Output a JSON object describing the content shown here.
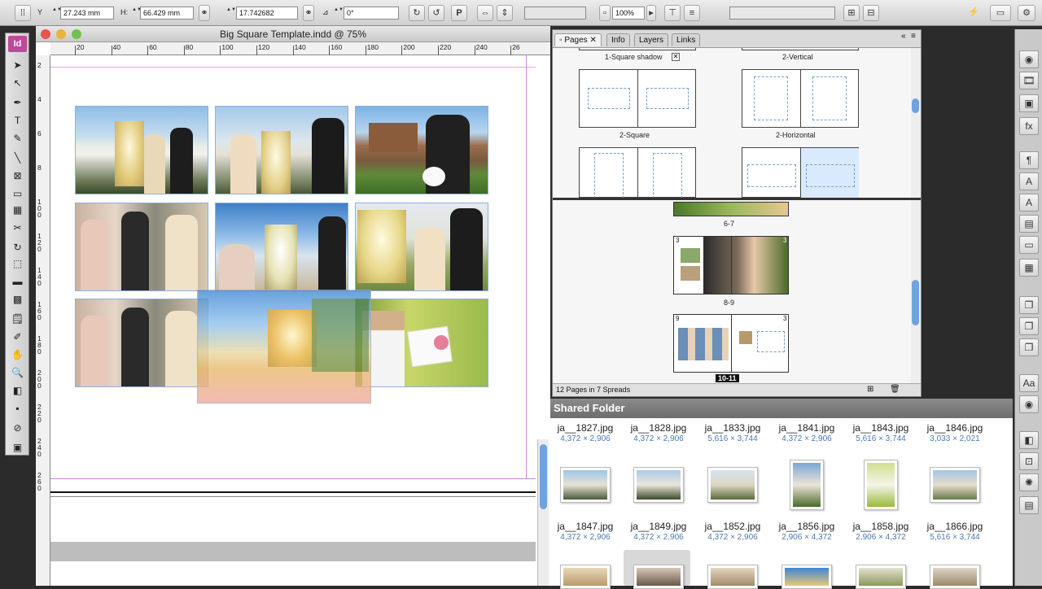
{
  "control_bar": {
    "y_label": "Y",
    "y_value": "27.243 mm",
    "h_label": "H:",
    "h_value": "66.429 mm",
    "scale_value": "17.742682",
    "angle_value": "0°",
    "zoom_value": "100%",
    "p_glyph": "P"
  },
  "tools": {
    "logo": "Id",
    "items": [
      {
        "name": "selection-tool",
        "glyph": "➤"
      },
      {
        "name": "direct-selection-tool",
        "glyph": "↖"
      },
      {
        "name": "pen-tool",
        "glyph": "✒"
      },
      {
        "name": "type-tool",
        "glyph": "T"
      },
      {
        "name": "pencil-tool",
        "glyph": "✎"
      },
      {
        "name": "line-tool",
        "glyph": "╲"
      },
      {
        "name": "rectangle-frame-tool",
        "glyph": "⊠"
      },
      {
        "name": "rectangle-tool",
        "glyph": "▭"
      },
      {
        "name": "table-tool",
        "glyph": "▦"
      },
      {
        "name": "scissors-tool",
        "glyph": "✂"
      },
      {
        "name": "rotate-tool",
        "glyph": "↻"
      },
      {
        "name": "free-transform-tool",
        "glyph": "⬚"
      },
      {
        "name": "gradient-tool",
        "glyph": "▬"
      },
      {
        "name": "gradient-feather-tool",
        "glyph": "▩"
      },
      {
        "name": "note-tool",
        "glyph": "🗒"
      },
      {
        "name": "eyedropper-tool",
        "glyph": "✐"
      },
      {
        "name": "hand-tool",
        "glyph": "✋"
      },
      {
        "name": "zoom-tool",
        "glyph": "🔍"
      },
      {
        "name": "fill-stroke-swatch",
        "glyph": "◧"
      },
      {
        "name": "apply-color",
        "glyph": "▪"
      },
      {
        "name": "apply-none",
        "glyph": "⊘"
      },
      {
        "name": "view-mode",
        "glyph": "▣"
      }
    ]
  },
  "document": {
    "title": "Big Square Template.indd @ 75%",
    "ruler_h": [
      "20",
      "40",
      "60",
      "80",
      "100",
      "120",
      "140",
      "160",
      "180",
      "200",
      "220",
      "240",
      "26"
    ],
    "ruler_v": [
      "2",
      "4",
      "6",
      "8",
      "1 0 0",
      "1 2 0",
      "1 4 0",
      "1 6 0",
      "1 8 0",
      "2 0 0",
      "2 2 0",
      "2 4 0",
      "2 6 0"
    ]
  },
  "pages_panel": {
    "tabs": [
      "Pages",
      "Info",
      "Layers",
      "Links"
    ],
    "masters": [
      {
        "label": "1-Square shadow"
      },
      {
        "label": "2-Vertical"
      },
      {
        "label": "2-Square"
      },
      {
        "label": "2-Horizontal"
      }
    ],
    "spreads": [
      {
        "label": "6-7"
      },
      {
        "label": "8-9",
        "left_num": "3",
        "right_num": "3"
      },
      {
        "label": "10-11",
        "left_num": "9",
        "right_num": "3"
      }
    ],
    "footer": "12 Pages in 7 Spreads"
  },
  "shared_folder": {
    "title": "Shared Folder",
    "row1": [
      {
        "name": "ja__1827.jpg",
        "size": "4,372 × 2,906"
      },
      {
        "name": "ja__1828.jpg",
        "size": "4,372 × 2,906"
      },
      {
        "name": "ja__1833.jpg",
        "size": "5,616 × 3,744"
      },
      {
        "name": "ja__1841.jpg",
        "size": "4,372 × 2,906"
      },
      {
        "name": "ja__1843.jpg",
        "size": "5,616 × 3,744"
      },
      {
        "name": "ja__1846.jpg",
        "size": "3,033 × 2,021"
      }
    ],
    "row2": [
      {
        "name": "ja__1847.jpg",
        "size": "4,372 × 2,906"
      },
      {
        "name": "ja__1849.jpg",
        "size": "4,372 × 2,906"
      },
      {
        "name": "ja__1852.jpg",
        "size": "4,372 × 2,906"
      },
      {
        "name": "ja__1856.jpg",
        "size": "2,906 × 4,372"
      },
      {
        "name": "ja__1858.jpg",
        "size": "2,906 × 4,372"
      },
      {
        "name": "ja__1866.jpg",
        "size": "5,616 × 3,744"
      }
    ]
  },
  "right_panel": {
    "icons": [
      "globe-icon",
      "film-icon",
      "image-icon",
      "fx-icon",
      "paragraph-icon",
      "character-icon",
      "type-icon",
      "styles-icon",
      "stroke-icon",
      "swatches-icon",
      "pages-stack-icon",
      "layers-stack-icon",
      "links-stack-icon",
      "glyphs-icon",
      "hyperlinks-icon",
      "pathfinder-icon",
      "align-icon",
      "effects-icon",
      "table-icon"
    ],
    "glyphs": [
      "◉",
      "🎞",
      "▣",
      "fx",
      "¶",
      "A",
      "A",
      "▤",
      "▭",
      "▦",
      "❐",
      "❐",
      "❐",
      "Aa",
      "◉",
      "◧",
      "⊡",
      "✺",
      "▤"
    ]
  }
}
